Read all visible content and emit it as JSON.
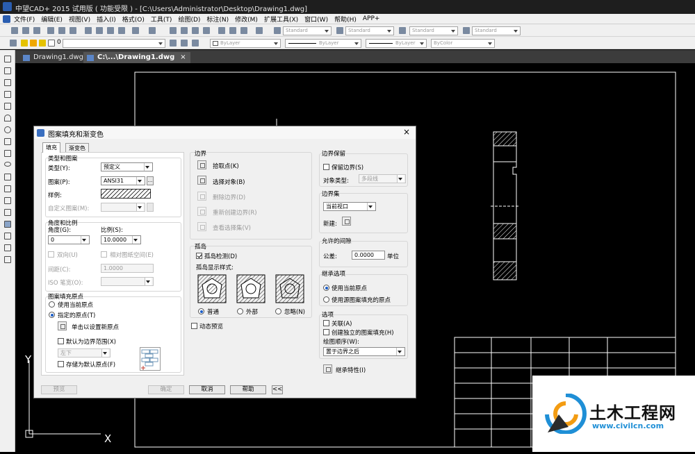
{
  "title": "中望CAD+ 2015 试用版 ( 功能受限 ) - [C:\\Users\\Administrator\\Desktop\\Drawing1.dwg]",
  "menu": [
    "文件(F)",
    "编辑(E)",
    "视图(V)",
    "插入(I)",
    "格式(O)",
    "工具(T)",
    "绘图(D)",
    "标注(N)",
    "修改(M)",
    "扩展工具(X)",
    "窗口(W)",
    "帮助(H)",
    "APP+"
  ],
  "toolbar": {
    "text_style": "Standard",
    "dim_style": "Standard",
    "table_style": "Standard",
    "multileader_style": "Standard",
    "layer_value": "0",
    "color": "ByLayer",
    "linetype": "ByLayer",
    "lineweight": "ByLayer",
    "plot_style": "ByColor"
  },
  "tabs": [
    {
      "label": "Drawing1.dwg",
      "close": ""
    },
    {
      "label": "C:\\...\\Drawing1.dwg",
      "close": "×"
    }
  ],
  "canvas": {
    "axis_y": "Y",
    "axis_x": "X"
  },
  "dialog": {
    "title": "图案填充和渐变色",
    "close": "×",
    "tab_hatch": "填充",
    "tab_gradient": "渐变色",
    "type_group": "类型和图案",
    "type_label": "类型(Y):",
    "type_value": "预定义",
    "pattern_label": "图案(P):",
    "pattern_value": "ANSI31",
    "pattern_more": "...",
    "swatch_label": "样例:",
    "custom_label": "自定义图案(M):",
    "angle_group": "角度和比例",
    "angle_label": "角度(G):",
    "angle_value": "0",
    "scale_label": "比例(S):",
    "scale_value": "10.0000",
    "double_label": "双向(U)",
    "relative_label": "相对图纸空间(E)",
    "spacing_label": "间距(C):",
    "spacing_value": "1.0000",
    "iso_label": "ISO 笔宽(O):",
    "origin_group": "图案填充原点",
    "origin_current": "使用当前原点",
    "origin_specified": "指定的原点(T)",
    "origin_click": "单击以设置新原点",
    "origin_default": "默认为边界范围(X)",
    "origin_pos": "左下",
    "origin_store": "存储为默认原点(F)",
    "boundary_group": "边界",
    "pick_points": "拾取点(K)",
    "select_objects": "选择对象(B)",
    "remove_boundary": "删除边界(D)",
    "recreate_boundary": "重新创建边界(R)",
    "view_selection": "查看选择集(V)",
    "islands_group": "孤岛",
    "island_detect": "孤岛检测(D)",
    "island_style_label": "孤岛显示样式:",
    "island_normal": "普通",
    "island_outer": "外部",
    "island_ignore": "忽略(N)",
    "dynamic_preview": "动态预览",
    "retain_group": "边界保留",
    "retain_boundary": "保留边界(S)",
    "object_type_label": "对象类型:",
    "object_type_value": "多段线",
    "boundary_set_group": "边界集",
    "boundary_set_value": "当前视口",
    "new_label": "新建:",
    "gap_group": "允许的间隙",
    "tolerance_label": "公差:",
    "tolerance_value": "0.0000",
    "unit_label": "单位",
    "inherit_group": "继承选项",
    "inherit_current": "使用当前原点",
    "inherit_source": "使用源图案填充的原点",
    "options_group": "选项",
    "associative": "关联(A)",
    "separate": "创建独立的图案填充(H)",
    "draw_order_label": "绘图顺序(W):",
    "draw_order_value": "置于边界之后",
    "inherit_props": "继承特性(I)",
    "preview": "预览",
    "ok": "确定",
    "cancel": "取消",
    "help": "帮助",
    "collapse": "<<"
  },
  "watermark": {
    "brand": "土木工程网",
    "url": "www.civilcn.com"
  }
}
